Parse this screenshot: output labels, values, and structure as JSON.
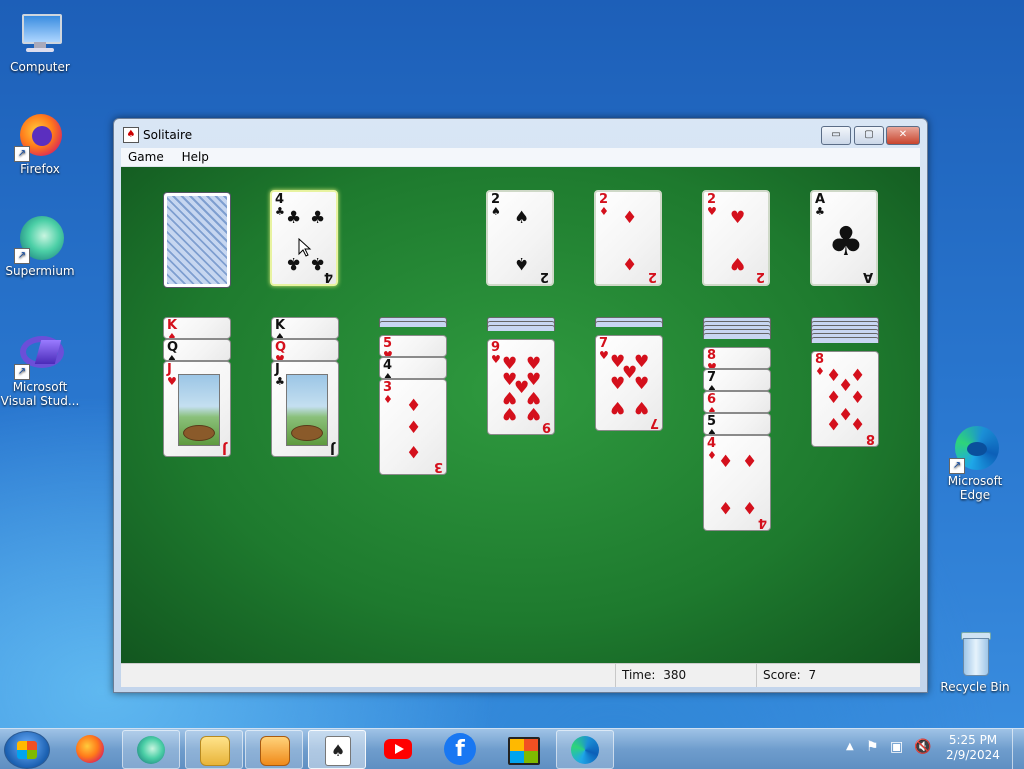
{
  "desktop": {
    "icons": [
      {
        "label": "Computer"
      },
      {
        "label": "Firefox"
      },
      {
        "label": "Supermium"
      },
      {
        "label": "Microsoft Visual Stud..."
      },
      {
        "label": "Microsoft Edge"
      },
      {
        "label": "Recycle Bin"
      }
    ]
  },
  "window": {
    "title": "Solitaire",
    "controls": {
      "minimize": "▭",
      "maximize": "▢",
      "close": "✕"
    },
    "menu": [
      "Game",
      "Help"
    ],
    "status": {
      "time_label": "Time:",
      "time_value": "380",
      "score_label": "Score:",
      "score_value": "7"
    }
  },
  "game": {
    "stock": {
      "face_down": true
    },
    "waste": {
      "top": {
        "rank": "4",
        "suit": "♣",
        "color": "black",
        "selected": true
      }
    },
    "foundations": [
      {
        "rank": "2",
        "suit": "♠",
        "color": "black"
      },
      {
        "rank": "2",
        "suit": "♦",
        "color": "red"
      },
      {
        "rank": "2",
        "suit": "♥",
        "color": "red"
      },
      {
        "rank": "A",
        "suit": "♣",
        "color": "black"
      }
    ],
    "tableau": [
      {
        "hidden": 0,
        "cards": [
          {
            "rank": "K",
            "suit": "♦",
            "color": "red"
          },
          {
            "rank": "Q",
            "suit": "♠",
            "color": "black"
          },
          {
            "rank": "J",
            "suit": "♥",
            "color": "red"
          }
        ]
      },
      {
        "hidden": 0,
        "cards": [
          {
            "rank": "K",
            "suit": "♠",
            "color": "black"
          },
          {
            "rank": "Q",
            "suit": "♥",
            "color": "red"
          },
          {
            "rank": "J",
            "suit": "♣",
            "color": "black"
          }
        ]
      },
      {
        "hidden": 2,
        "cards": [
          {
            "rank": "5",
            "suit": "♥",
            "color": "red"
          },
          {
            "rank": "4",
            "suit": "♠",
            "color": "black"
          },
          {
            "rank": "3",
            "suit": "♦",
            "color": "red"
          }
        ]
      },
      {
        "hidden": 3,
        "cards": [
          {
            "rank": "9",
            "suit": "♥",
            "color": "red"
          }
        ]
      },
      {
        "hidden": 2,
        "cards": [
          {
            "rank": "7",
            "suit": "♥",
            "color": "red"
          }
        ]
      },
      {
        "hidden": 5,
        "cards": [
          {
            "rank": "8",
            "suit": "♥",
            "color": "red"
          },
          {
            "rank": "7",
            "suit": "♠",
            "color": "black"
          },
          {
            "rank": "6",
            "suit": "♦",
            "color": "red"
          },
          {
            "rank": "5",
            "suit": "♠",
            "color": "black"
          },
          {
            "rank": "4",
            "suit": "♦",
            "color": "red"
          }
        ]
      },
      {
        "hidden": 6,
        "cards": [
          {
            "rank": "8",
            "suit": "♦",
            "color": "red"
          }
        ]
      }
    ]
  },
  "taskbar": {
    "items": [
      {
        "name": "firefox",
        "state": "plain"
      },
      {
        "name": "supermium",
        "state": "pinned"
      },
      {
        "name": "file-explorer",
        "state": "pinned"
      },
      {
        "name": "media-player",
        "state": "pinned"
      },
      {
        "name": "solitaire",
        "state": "active"
      },
      {
        "name": "youtube",
        "state": "plain"
      },
      {
        "name": "facebook",
        "state": "plain"
      },
      {
        "name": "store",
        "state": "plain"
      },
      {
        "name": "edge",
        "state": "pinned"
      }
    ],
    "clock": {
      "time": "5:25 PM",
      "date": "2/9/2024"
    }
  }
}
